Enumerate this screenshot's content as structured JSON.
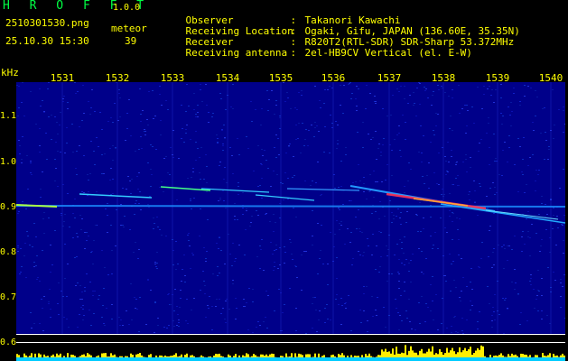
{
  "header": {
    "app_title": "H R O F F T",
    "app_version": "1.0.0",
    "file_name": "2510301530.png",
    "meteor_label": "meteor",
    "date_time": "25.10.30 15:30",
    "meteor_count": "39",
    "info": [
      {
        "label": "Observer",
        "value": "Takanori Kawachi"
      },
      {
        "label": "Receiving Location",
        "value": "Ogaki, Gifu, JAPAN (136.60E, 35.35N)"
      },
      {
        "label": "Receiver",
        "value": "R820T2(RTL-SDR) SDR-Sharp 53.372MHz"
      },
      {
        "label": "Receiving antenna",
        "value": "2el-HB9CV Vertical (el. E-W)"
      }
    ]
  },
  "axes": {
    "freq_unit": "kHz",
    "time_ticks": [
      "1531",
      "1532",
      "1533",
      "1534",
      "1535",
      "1536",
      "1537",
      "1538",
      "1539",
      "1540"
    ],
    "freq_ticks": [
      "1.1",
      "1.0",
      "0.9",
      "0.8",
      "0.7",
      "0.6"
    ]
  },
  "colors": {
    "background": "#000000",
    "plot_bg": "#00008a",
    "label": "#ffff00",
    "title": "#00ff44",
    "trace": "#00e0ff",
    "level_bars": "#ffee00",
    "level_base": "#00ccff"
  }
}
